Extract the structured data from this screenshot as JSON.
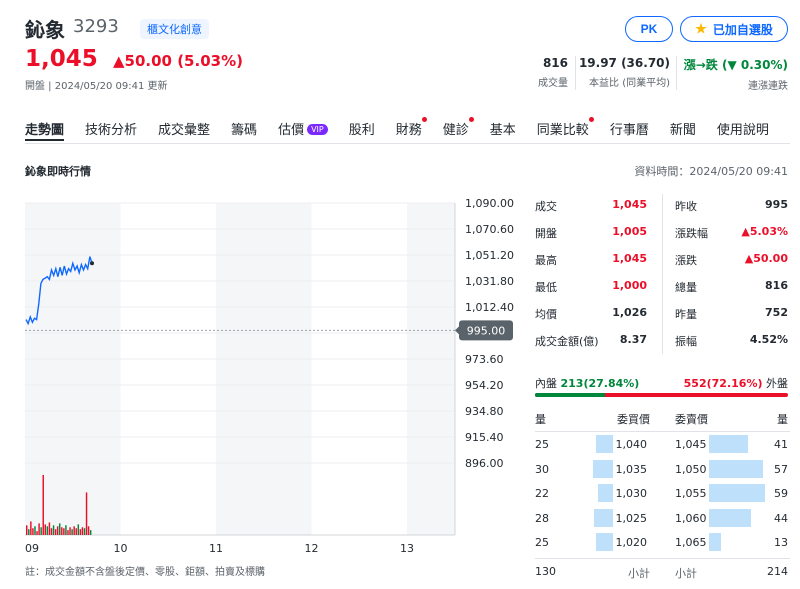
{
  "header": {
    "name": "鈊象",
    "code": "3293",
    "tag": "櫃文化創意",
    "price": "1,045",
    "change": "▲50.00 (5.03%)",
    "status_line": "開盤 | 2024/05/20 09:41 更新",
    "pk_label": "PK",
    "fav_label": "已加自選股"
  },
  "stats": [
    {
      "value": "816",
      "label": "成交量"
    },
    {
      "value": "19.97 (36.70)",
      "label": "本益比 (同業平均)"
    },
    {
      "value": "漲→跌 (▼ 0.30%)",
      "label": "連漲連跌"
    }
  ],
  "tabs": [
    "走勢圖",
    "技術分析",
    "成交彙整",
    "籌碼",
    "估價",
    "股利",
    "財務",
    "健診",
    "基本",
    "同業比較",
    "行事曆",
    "新聞",
    "使用說明"
  ],
  "tab_vip": "VIP",
  "section": {
    "title": "鈊象即時行情",
    "time": "資料時間：2024/05/20 09:41"
  },
  "chart_data": {
    "type": "line",
    "y_ticks": [
      "1,090.00",
      "1,070.60",
      "1,051.20",
      "1,031.80",
      "1,012.40",
      "995.00",
      "973.60",
      "954.20",
      "934.80",
      "915.40",
      "896.00"
    ],
    "x_ticks": [
      "09",
      "10",
      "11",
      "12",
      "13"
    ],
    "ylim": [
      896,
      1090
    ],
    "ref_price": 995,
    "ref_label": "995.00",
    "series": [
      {
        "values": [
          1003,
          1000,
          1005,
          1001,
          1004,
          1003,
          1015,
          1030,
          1033,
          1034,
          1035,
          1033,
          1040,
          1036,
          1041,
          1035,
          1042,
          1036,
          1043,
          1037,
          1041,
          1039,
          1045,
          1040,
          1043,
          1038,
          1044,
          1040,
          1044,
          1041,
          1050,
          1045
        ]
      }
    ],
    "volume": [
      10,
      6,
      14,
      7,
      9,
      4,
      12,
      8,
      62,
      11,
      9,
      13,
      7,
      10,
      6,
      9,
      12,
      8,
      7,
      10,
      5,
      8,
      6,
      9,
      7,
      11,
      6,
      8,
      7,
      44,
      9,
      5
    ]
  },
  "quotes": [
    {
      "l1": "成交",
      "v1": "1,045",
      "c1": "up",
      "l2": "昨收",
      "v2": "995",
      "c2": ""
    },
    {
      "l1": "開盤",
      "v1": "1,005",
      "c1": "up",
      "l2": "漲跌幅",
      "v2": "▲5.03%",
      "c2": "up"
    },
    {
      "l1": "最高",
      "v1": "1,045",
      "c1": "up",
      "l2": "漲跌",
      "v2": "▲50.00",
      "c2": "up"
    },
    {
      "l1": "最低",
      "v1": "1,000",
      "c1": "up",
      "l2": "總量",
      "v2": "816",
      "c2": ""
    },
    {
      "l1": "均價",
      "v1": "1,026",
      "c1": "",
      "l2": "昨量",
      "v2": "752",
      "c2": ""
    },
    {
      "l1": "成交金額(億)",
      "v1": "8.37",
      "c1": "",
      "l2": "振幅",
      "v2": "4.52%",
      "c2": ""
    }
  ],
  "flow": {
    "in_label": "內盤",
    "in_value": "213(27.84%)",
    "in_pct": 27.84,
    "out_value": "552(72.16%)",
    "out_label": "外盤"
  },
  "orderbook": {
    "headers": [
      "量",
      "委買價",
      "委賣價",
      "量"
    ],
    "rows": [
      {
        "bq": "25",
        "bp": "1,040",
        "ap": "1,045",
        "aq": "41"
      },
      {
        "bq": "30",
        "bp": "1,035",
        "ap": "1,050",
        "aq": "57"
      },
      {
        "bq": "22",
        "bp": "1,030",
        "ap": "1,055",
        "aq": "59"
      },
      {
        "bq": "28",
        "bp": "1,025",
        "ap": "1,060",
        "aq": "44"
      },
      {
        "bq": "25",
        "bp": "1,020",
        "ap": "1,065",
        "aq": "13"
      }
    ],
    "total_label": "小計",
    "bid_total": "130",
    "ask_total": "214"
  },
  "footnote": "註：成交金額不含盤後定價、零股、鉅額、拍賣及標購"
}
